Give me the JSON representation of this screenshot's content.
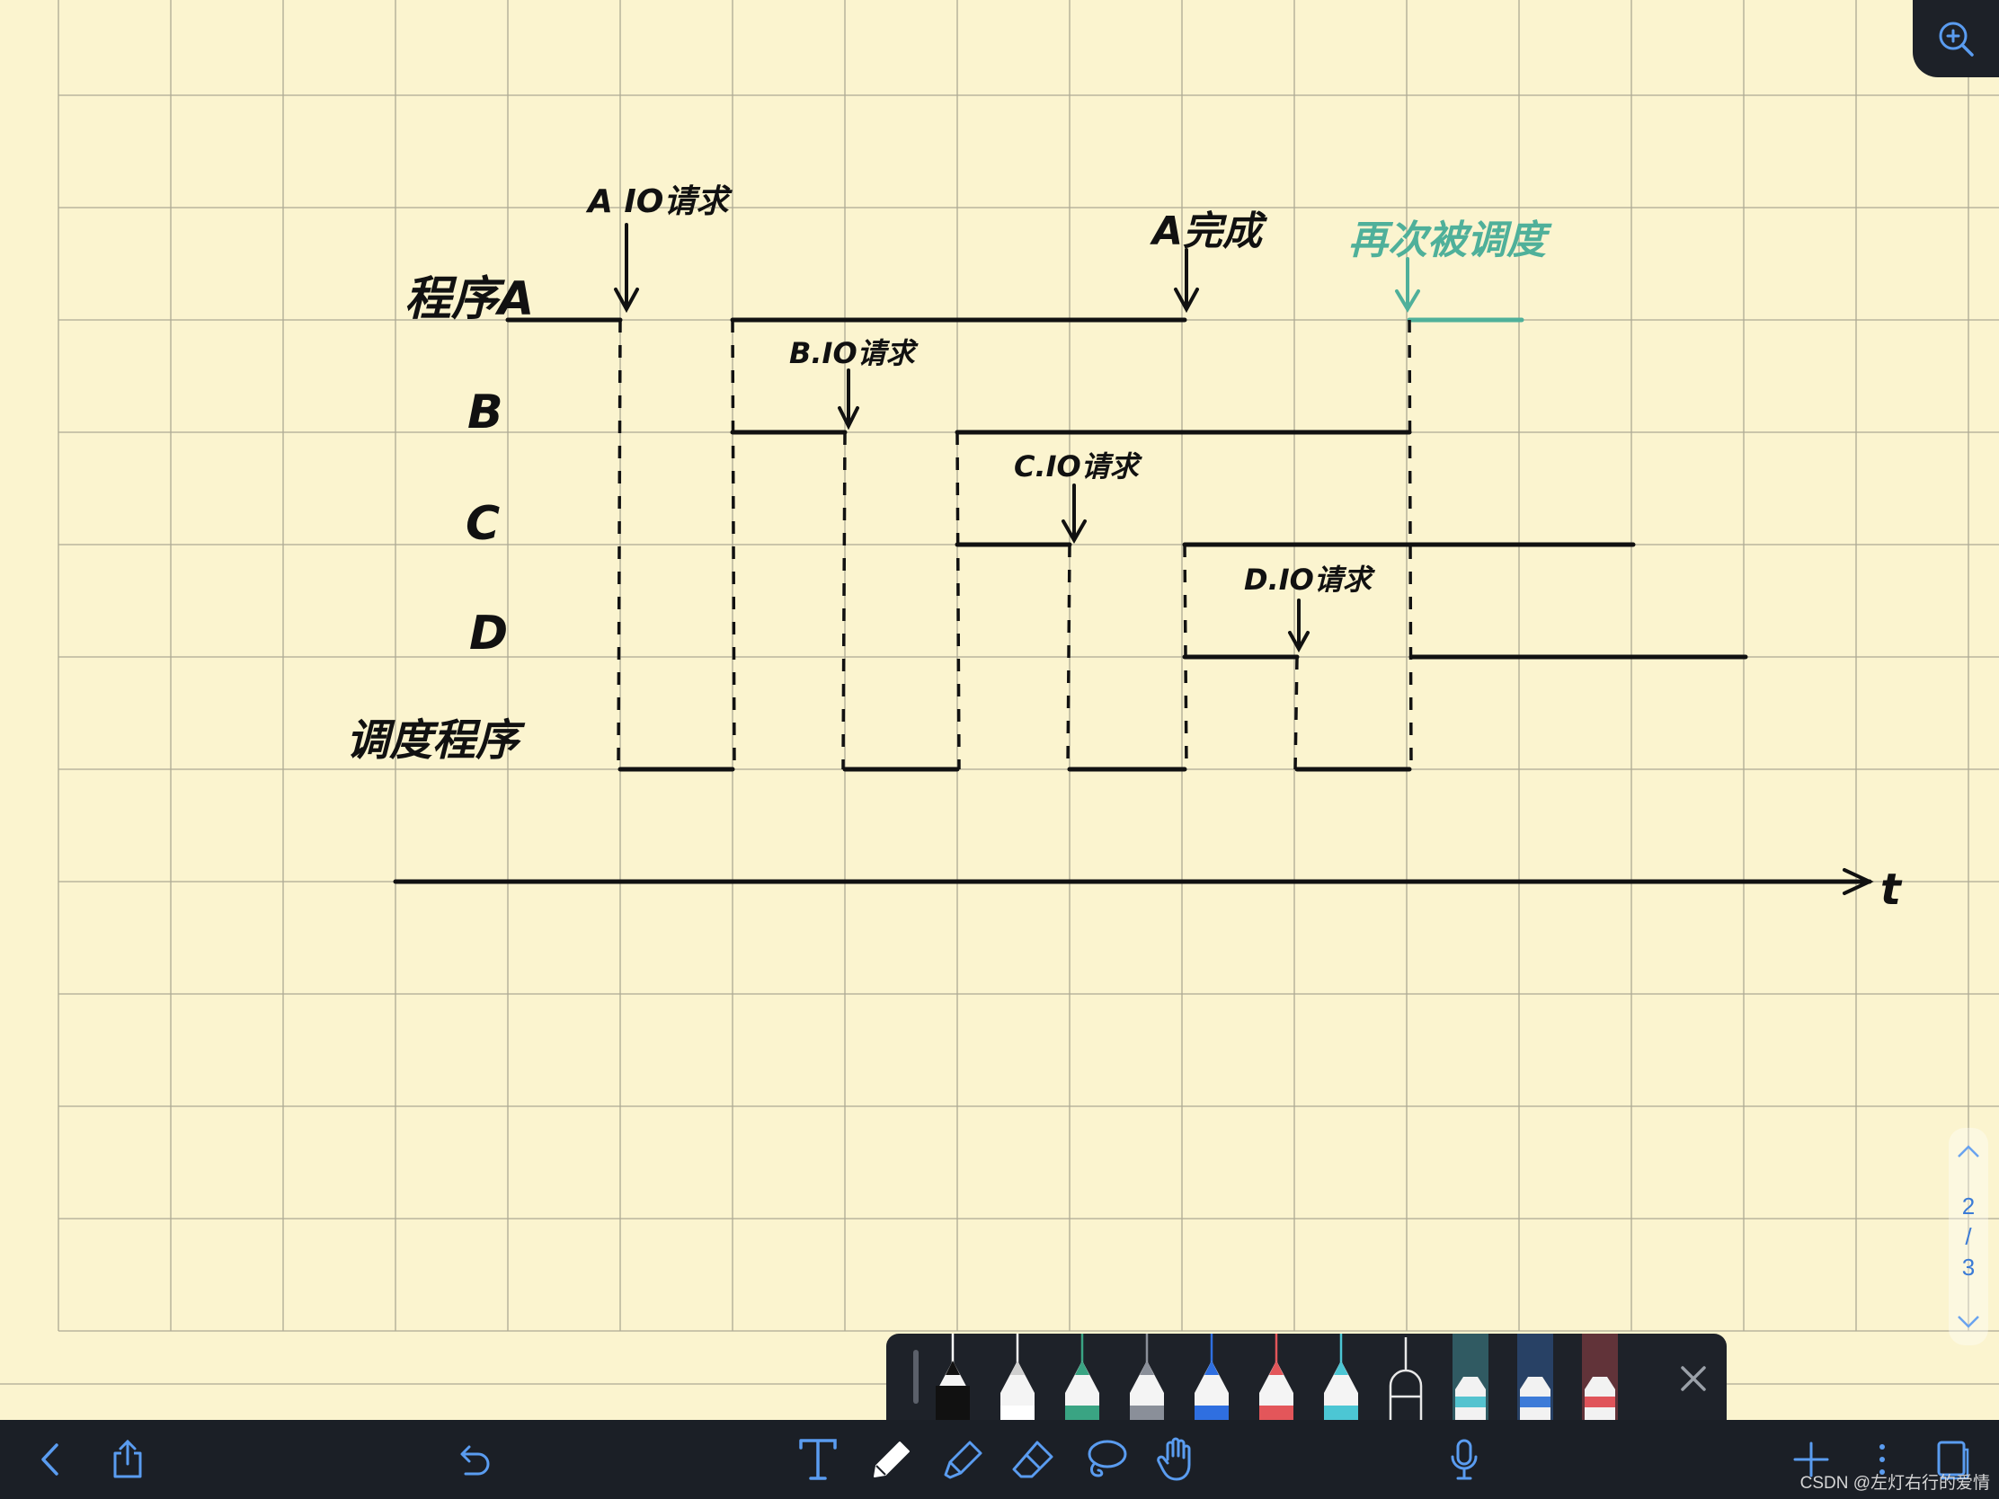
{
  "labels": {
    "prog_a": "程序A",
    "prog_b": "B",
    "prog_c": "C",
    "prog_d": "D",
    "scheduler": "调度程序",
    "axis_t": "t"
  },
  "annotations": {
    "a_io": "A IO请求",
    "a_done": "A完成",
    "rescheduled": "再次被调度",
    "b_io": "B.IO请求",
    "c_io": "C.IO请求",
    "d_io": "D.IO请求"
  },
  "colors": {
    "paper": "#fbf4cf",
    "grid": "#8c8a7c",
    "ink": "#111111",
    "green_ink": "#4fb09a"
  },
  "page_indicator": {
    "current": "2",
    "separator": "/",
    "total": "3"
  },
  "pens": [
    {
      "name": "black-pen",
      "color": "#111111"
    },
    {
      "name": "white-pen",
      "color": "#f4f4f4"
    },
    {
      "name": "green-pen",
      "color": "#3aa483"
    },
    {
      "name": "gray-pen",
      "color": "#8a8f99"
    },
    {
      "name": "blue-pen",
      "color": "#2f6fe0"
    },
    {
      "name": "red-pen",
      "color": "#e3565a"
    },
    {
      "name": "cyan-pen",
      "color": "#4cc6d4"
    },
    {
      "name": "outline-pen",
      "color": "#1e2229"
    },
    {
      "name": "teal-highlighter",
      "color": "#54c3cf"
    },
    {
      "name": "navy-highlighter",
      "color": "#3d7bd8"
    },
    {
      "name": "red-highlighter",
      "color": "#e0545a"
    }
  ],
  "icons": {
    "zoom": "zoom-in-icon",
    "back": "chevron-left-icon",
    "share": "share-icon",
    "undo": "undo-icon",
    "text": "text-tool-icon",
    "pen": "pen-tool-icon",
    "highlighter": "highlighter-tool-icon",
    "eraser": "eraser-tool-icon",
    "lasso": "lasso-tool-icon",
    "hand": "hand-tool-icon",
    "mic": "microphone-icon",
    "add": "add-page-icon",
    "more": "more-icon",
    "pages": "pages-icon",
    "close_tray": "close-icon"
  },
  "watermark": "CSDN @左灯右行的爱情"
}
